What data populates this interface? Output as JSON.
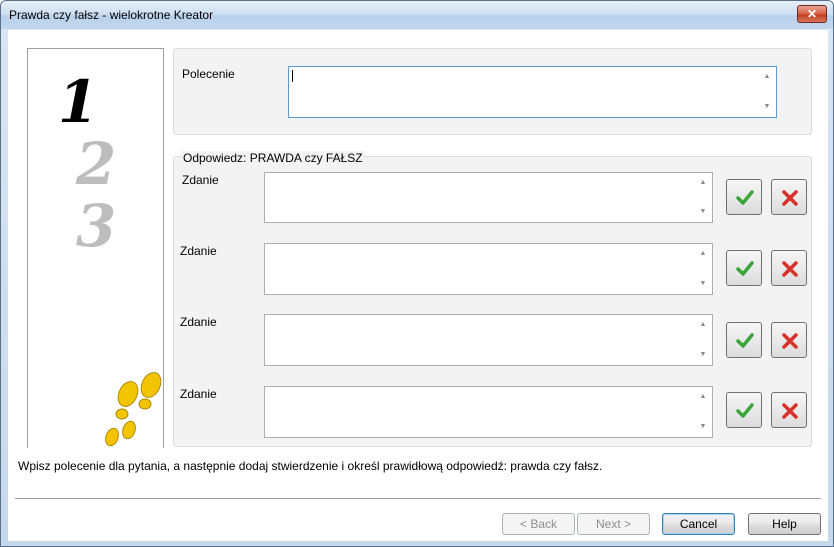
{
  "window": {
    "title": "Prawda czy fałsz - wielokrotne Kreator",
    "close_label": "✕"
  },
  "steps_panel": {
    "step_1": "1",
    "step_2": "2",
    "step_3": "3",
    "footprints_icon": "footprints-icon"
  },
  "instruction_group": {
    "label": "Polecenie",
    "value": ""
  },
  "answer_group": {
    "title": "Odpowiedz: PRAWDA czy FAŁSZ",
    "statements": [
      {
        "label": "Zdanie",
        "value": ""
      },
      {
        "label": "Zdanie",
        "value": ""
      },
      {
        "label": "Zdanie",
        "value": ""
      },
      {
        "label": "Zdanie",
        "value": ""
      }
    ]
  },
  "hint": "Wpisz polecenie dla pytania, a następnie dodaj stwierdzenie i określ prawidłową odpowiedź: prawda czy fałsz.",
  "buttons": {
    "back": "< Back",
    "next": "Next >",
    "cancel": "Cancel",
    "help": "Help"
  },
  "colors": {
    "true_green": "#3aa53a",
    "false_red": "#d8302a",
    "footprint_yellow": "#f2c500",
    "active_step": "#000000",
    "inactive_step": "#bdbdbd"
  }
}
